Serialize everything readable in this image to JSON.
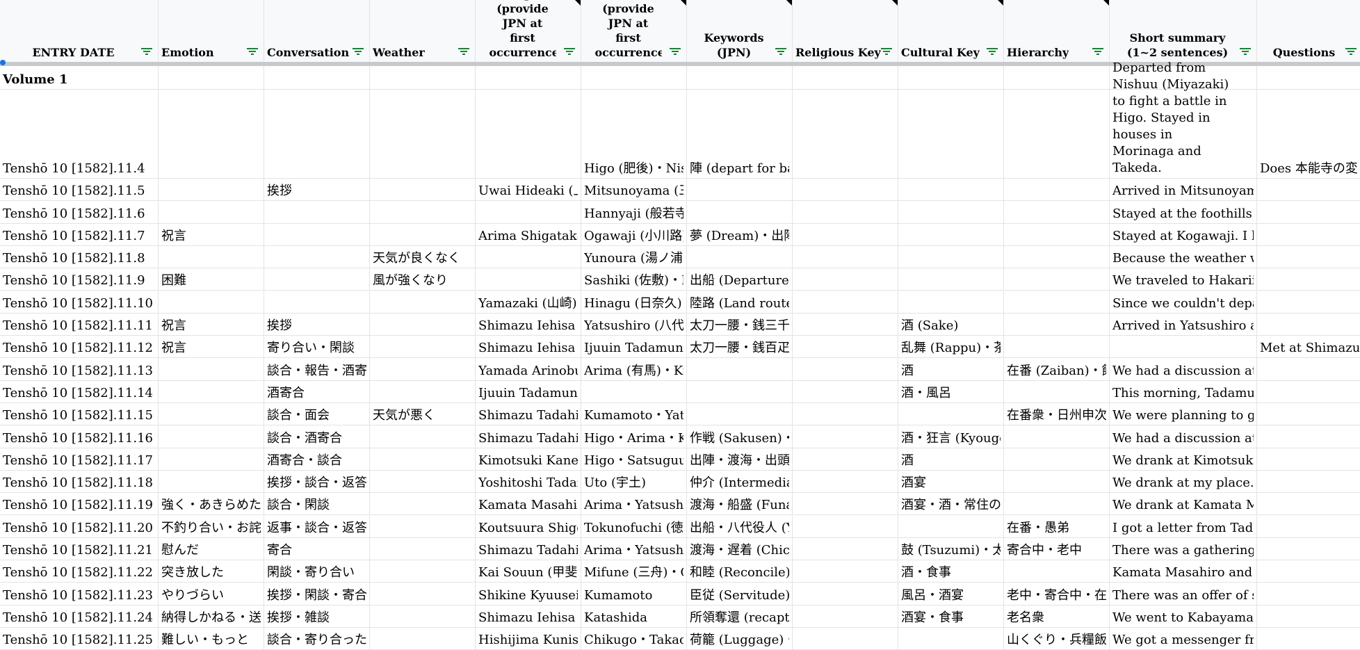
{
  "columns": [
    {
      "key": "date",
      "label": "ENTRY DATE"
    },
    {
      "key": "emotion",
      "label": "Emotion"
    },
    {
      "key": "conversation",
      "label": "Conversation"
    },
    {
      "key": "weather",
      "label": "Weather"
    },
    {
      "key": "people",
      "label": "People (provide JPN at first occurrence)"
    },
    {
      "key": "places",
      "label": "Places (provide JPN at first occurrence)"
    },
    {
      "key": "keywords",
      "label": "Keywords (JPN)"
    },
    {
      "key": "religious",
      "label": "Religious Key"
    },
    {
      "key": "cultural",
      "label": "Cultural Key"
    },
    {
      "key": "hierarchy",
      "label": "Hierarchy"
    },
    {
      "key": "summary",
      "label": "Short summary (1~2 sentences)"
    },
    {
      "key": "questions",
      "label": "Questions"
    }
  ],
  "section_label": "Volume 1",
  "rows": [
    {
      "date": "Tenshō 10 [1582].11.4",
      "emotion": "",
      "conversation": "",
      "weather": "",
      "people": "",
      "places": "Higo (肥後)・Nis",
      "keywords": "陣 (depart for battle)",
      "religious": "",
      "cultural": "",
      "hierarchy": "",
      "summary": "Departed from Nishuu (Miyazaki) to fight a battle in Higo. Stayed in houses in Morinaga and Takeda.",
      "questions": "Does 本能寺の変 a"
    },
    {
      "date": "Tenshō 10 [1582].11.5",
      "emotion": "",
      "conversation": "挨拶",
      "weather": "",
      "people": "Uwai Hideaki (上",
      "places": "Mitsunoyama (三之山)・Yatsushiro (八代)",
      "keywords": "",
      "religious": "",
      "cultural": "",
      "hierarchy": "",
      "summary": "Arrived in Mitsunoyama. Went to greet Uwa",
      "questions": ""
    },
    {
      "date": "Tenshō 10 [1582].11.6",
      "emotion": "",
      "conversation": "",
      "weather": "",
      "people": "",
      "places": "Hannyaji (般若寺)",
      "keywords": "",
      "religious": "",
      "cultural": "",
      "hierarchy": "",
      "summary": "Stayed at the foothills of Hannyaji.",
      "questions": ""
    },
    {
      "date": "Tenshō 10 [1582].11.7",
      "emotion": "祝言",
      "conversation": "",
      "weather": "",
      "people": "Arima Shigataka (",
      "places": "Ogawaji (小川路)",
      "keywords": "夢 (Dream)・出陣",
      "religious": "",
      "cultural": "",
      "hierarchy": "",
      "summary": "Stayed at Kogawaji. I had a dream where Ta",
      "questions": ""
    },
    {
      "date": "Tenshō 10 [1582].11.8",
      "emotion": "",
      "conversation": "",
      "weather": "天気が良くなく",
      "people": "",
      "places": "Yunoura (湯ノ浦)",
      "keywords": "",
      "religious": "",
      "cultural": "",
      "hierarchy": "",
      "summary": "Because the weather was bad, we were final",
      "questions": ""
    },
    {
      "date": "Tenshō 10 [1582].11.9",
      "emotion": "困難",
      "conversation": "",
      "weather": "風が強くなり",
      "people": "",
      "places": "Sashiki (佐敷)・H",
      "keywords": "出船 (Departure by boat)",
      "religious": "",
      "cultural": "",
      "hierarchy": "",
      "summary": "We traveled to Hakariishi in order to depart",
      "questions": ""
    },
    {
      "date": "Tenshō 10 [1582].11.10",
      "emotion": "",
      "conversation": "",
      "weather": "",
      "people": "Yamazaki (山崎)",
      "places": "Hinagu (日奈久)",
      "keywords": "陸路 (Land route)・出船",
      "religious": "",
      "cultural": "",
      "hierarchy": "",
      "summary": "Since we couldn't depart by boat today eithe",
      "questions": ""
    },
    {
      "date": "Tenshō 10 [1582].11.11",
      "emotion": "祝言",
      "conversation": "挨拶",
      "weather": "",
      "people": "Shimazu Iehisa (島",
      "places": "Yatsushiro (八代)",
      "keywords": "太刀一腰・銭三千疋 (Zeni Sanzenh",
      "religious": "",
      "cultural": "酒 (Sake)",
      "hierarchy": "",
      "summary": "Arrived in Yatsushiro and gave Tadahira an",
      "questions": ""
    },
    {
      "date": "Tenshō 10 [1582].11.12",
      "emotion": "祝言",
      "conversation": "寄り合い・閑談",
      "weather": "",
      "people": "Shimazu Iehisa・I",
      "places": "Ijuuin Tadamune・",
      "keywords": "太刀一腰・銭百疋",
      "religious": "",
      "cultural": "乱舞 (Rappu)・茶の湯 (Cha no yu)",
      "hierarchy": "",
      "summary": "",
      "questions": "Met at Shimazu Ie"
    },
    {
      "date": "Tenshō 10 [1582].11.13",
      "emotion": "",
      "conversation": "談合・報告・酒寄合",
      "weather": "",
      "people": "Yamada Arinobu (",
      "places": "Arima (有馬)・Kumamoto (隅本)",
      "keywords": "",
      "religious": "",
      "cultural": "酒",
      "hierarchy": "在番 (Zaiban)・飯",
      "summary": "We had a discussion at Tadahira's shelter. W",
      "questions": ""
    },
    {
      "date": "Tenshō 10 [1582].11.14",
      "emotion": "",
      "conversation": "酒寄合",
      "weather": "",
      "people": "Ijuuin Tadamune・Kimotsuki Kanehiro (肝付兼寛)・Niiro Hisaatsu・Kar",
      "places": "",
      "keywords": "",
      "religious": "",
      "cultural": "酒・風呂",
      "hierarchy": "",
      "summary": "This morning, Tadamune and the other came",
      "questions": ""
    },
    {
      "date": "Tenshō 10 [1582].11.15",
      "emotion": "",
      "conversation": "談合・面会",
      "weather": "天気が悪く",
      "people": "Shimazu Tadahira",
      "places": "Kumamoto・Yatsushiro・Chikugo (筑後)",
      "keywords": "",
      "religious": "",
      "cultural": "",
      "hierarchy": "在番衆・日州申次",
      "summary": "We were planning to go to Kumamoto/Yats",
      "questions": ""
    },
    {
      "date": "Tenshō 10 [1582].11.16",
      "emotion": "",
      "conversation": "談合・酒寄合",
      "weather": "",
      "people": "Shimazu Tadahira",
      "places": "Higo・Arima・Ka",
      "keywords": "作戦 (Sakusen)・渡海 (Tokai)",
      "religious": "",
      "cultural": "酒・狂言 (Kyougen)・酒宴",
      "hierarchy": "",
      "summary": "We had a discussion at Tadahira's shelter. W",
      "questions": ""
    },
    {
      "date": "Tenshō 10 [1582].11.17",
      "emotion": "",
      "conversation": "酒寄合・談合",
      "weather": "",
      "people": "Kimotsuki Kanehi",
      "places": "Higo・Satsuguuni",
      "keywords": "出陣・渡海・出頭 (Shuttou)",
      "religious": "",
      "cultural": "酒",
      "hierarchy": "",
      "summary": "We drank at Kimotsuki Kanehiro's place and",
      "questions": ""
    },
    {
      "date": "Tenshō 10 [1582].11.18",
      "emotion": "",
      "conversation": "挨拶・談合・返答",
      "weather": "",
      "people": "Yoshitoshi Tadazu",
      "places": "Uto (宇土)",
      "keywords": "仲介 (Intermediary)",
      "religious": "",
      "cultural": "酒宴",
      "hierarchy": "",
      "summary": "We drank at my place. Later, I got a message",
      "questions": ""
    },
    {
      "date": "Tenshō 10 [1582].11.19",
      "emotion": "強く・あきらめた",
      "conversation": "談合・閑談",
      "weather": "",
      "people": "Kamata Masahiro",
      "places": "Arima・Yatsushir",
      "keywords": "渡海・船盛 (Funamori)",
      "religious": "",
      "cultural": "酒宴・酒・常住の食 (Joujuu no Sho",
      "hierarchy": "",
      "summary": "We drank at Kamata Masahiro's place. We a",
      "questions": ""
    },
    {
      "date": "Tenshō 10 [1582].11.20",
      "emotion": "不釣り合い・お詫",
      "conversation": "返事・談合・返答",
      "weather": "",
      "people": "Koutsuura Shigesa",
      "places": "Tokunofuchi (徳淵",
      "keywords": "出船・八代役人 (Yatsushiro Official)・渡海",
      "religious": "",
      "cultural": "",
      "hierarchy": "在番・愚弟",
      "summary": "I got a letter from Tadahira asking me if I co",
      "questions": ""
    },
    {
      "date": "Tenshō 10 [1582].11.21",
      "emotion": "慰んだ",
      "conversation": "寄合",
      "weather": "",
      "people": "Shimazu Tadahira",
      "places": "Arima・Yatsushir",
      "keywords": "渡海・遅着 (Chichaku)",
      "religious": "",
      "cultural": "鼓 (Tsuzumi)・太",
      "hierarchy": "寄合中・老中",
      "summary": "There was a gathering at Tadahira's place, ar",
      "questions": ""
    },
    {
      "date": "Tenshō 10 [1582].11.22",
      "emotion": "突き放した",
      "conversation": "閑談・寄り合い",
      "weather": "",
      "people": "Kai Souun (甲斐宗",
      "places": "Mifune (三舟)・C",
      "keywords": "和睦 (Reconcile)",
      "religious": "",
      "cultural": "酒・食事",
      "hierarchy": "",
      "summary": "Kamata Masahiro and Hishijima Kunisada n",
      "questions": ""
    },
    {
      "date": "Tenshō 10 [1582].11.23",
      "emotion": "やりづらい",
      "conversation": "挨拶・閑談・寄合・談合・返答",
      "weather": "",
      "people": "Shikine Kyuuseisa",
      "places": "Kumamoto",
      "keywords": "臣従 (Servitude)・仲介・交渉",
      "religious": "",
      "cultural": "風呂・酒宴",
      "hierarchy": "老中・寄合中・在",
      "summary": "There was an offer of servitude from Goushi",
      "questions": ""
    },
    {
      "date": "Tenshō 10 [1582].11.24",
      "emotion": "納得しかねる・送",
      "conversation": "挨拶・雑談",
      "weather": "",
      "people": "Shimazu Iehisa・I",
      "places": "Katashida",
      "keywords": "所領奪還 (recapture territory)・和平",
      "religious": "",
      "cultural": "酒宴・食事",
      "hierarchy": "老名衆",
      "summary": "We went to Kabayama Gensa's inn and ate d",
      "questions": ""
    },
    {
      "date": "Tenshō 10 [1582].11.25",
      "emotion": "難しい・もっと",
      "conversation": "談合・寄り合った",
      "weather": "",
      "people": "Hishijima Kunisad",
      "places": "Chikugo・Takaoj",
      "keywords": "荷籠 (Luggage)・和睦 (Peace)・人質 (Hostage)・兵船",
      "religious": "",
      "cultural": "",
      "hierarchy": "山くぐり・兵糧飯",
      "summary": "We got a messenger from Takao Castle sayin",
      "questions": ""
    }
  ],
  "colors": {
    "header_bg": "#f8f9fa",
    "grid": "#e2e3e3",
    "freeze": "#c7c9cc",
    "selection": "#1a73e8"
  },
  "icons": {
    "filter": "filter-icon"
  }
}
